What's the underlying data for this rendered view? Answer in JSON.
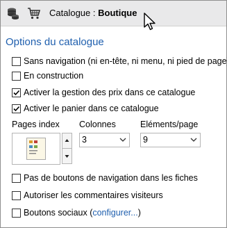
{
  "header": {
    "title_prefix": "Catalogue : ",
    "title_name": "Boutique",
    "icons": [
      "coins-stack-icon",
      "shopping-cart-icon"
    ]
  },
  "options": {
    "section_title": "Options du catalogue",
    "checkboxes": [
      {
        "label": "Sans navigation (ni en-tête, ni menu, ni pied de page)",
        "checked": false
      },
      {
        "label": "En construction",
        "checked": false
      },
      {
        "label": "Activer la gestion des prix dans ce catalogue",
        "checked": true
      },
      {
        "label": "Activer le panier dans ce catalogue",
        "checked": true
      }
    ],
    "pages_index": {
      "label": "Pages index"
    },
    "colonnes": {
      "label": "Colonnes",
      "value": "3"
    },
    "elements": {
      "label": "Eléments/page",
      "value": "9"
    },
    "lower_checkboxes": [
      {
        "label": "Pas de boutons de navigation dans les fiches",
        "checked": false
      },
      {
        "label": "Autoriser les commentaires visiteurs",
        "checked": false
      }
    ],
    "social": {
      "label": "Boutons sociaux (",
      "link": "configurer...",
      "suffix": ")",
      "checked": false
    }
  },
  "colors": {
    "accent": "#1f5fae",
    "header_bg": "#e9e9ea"
  }
}
